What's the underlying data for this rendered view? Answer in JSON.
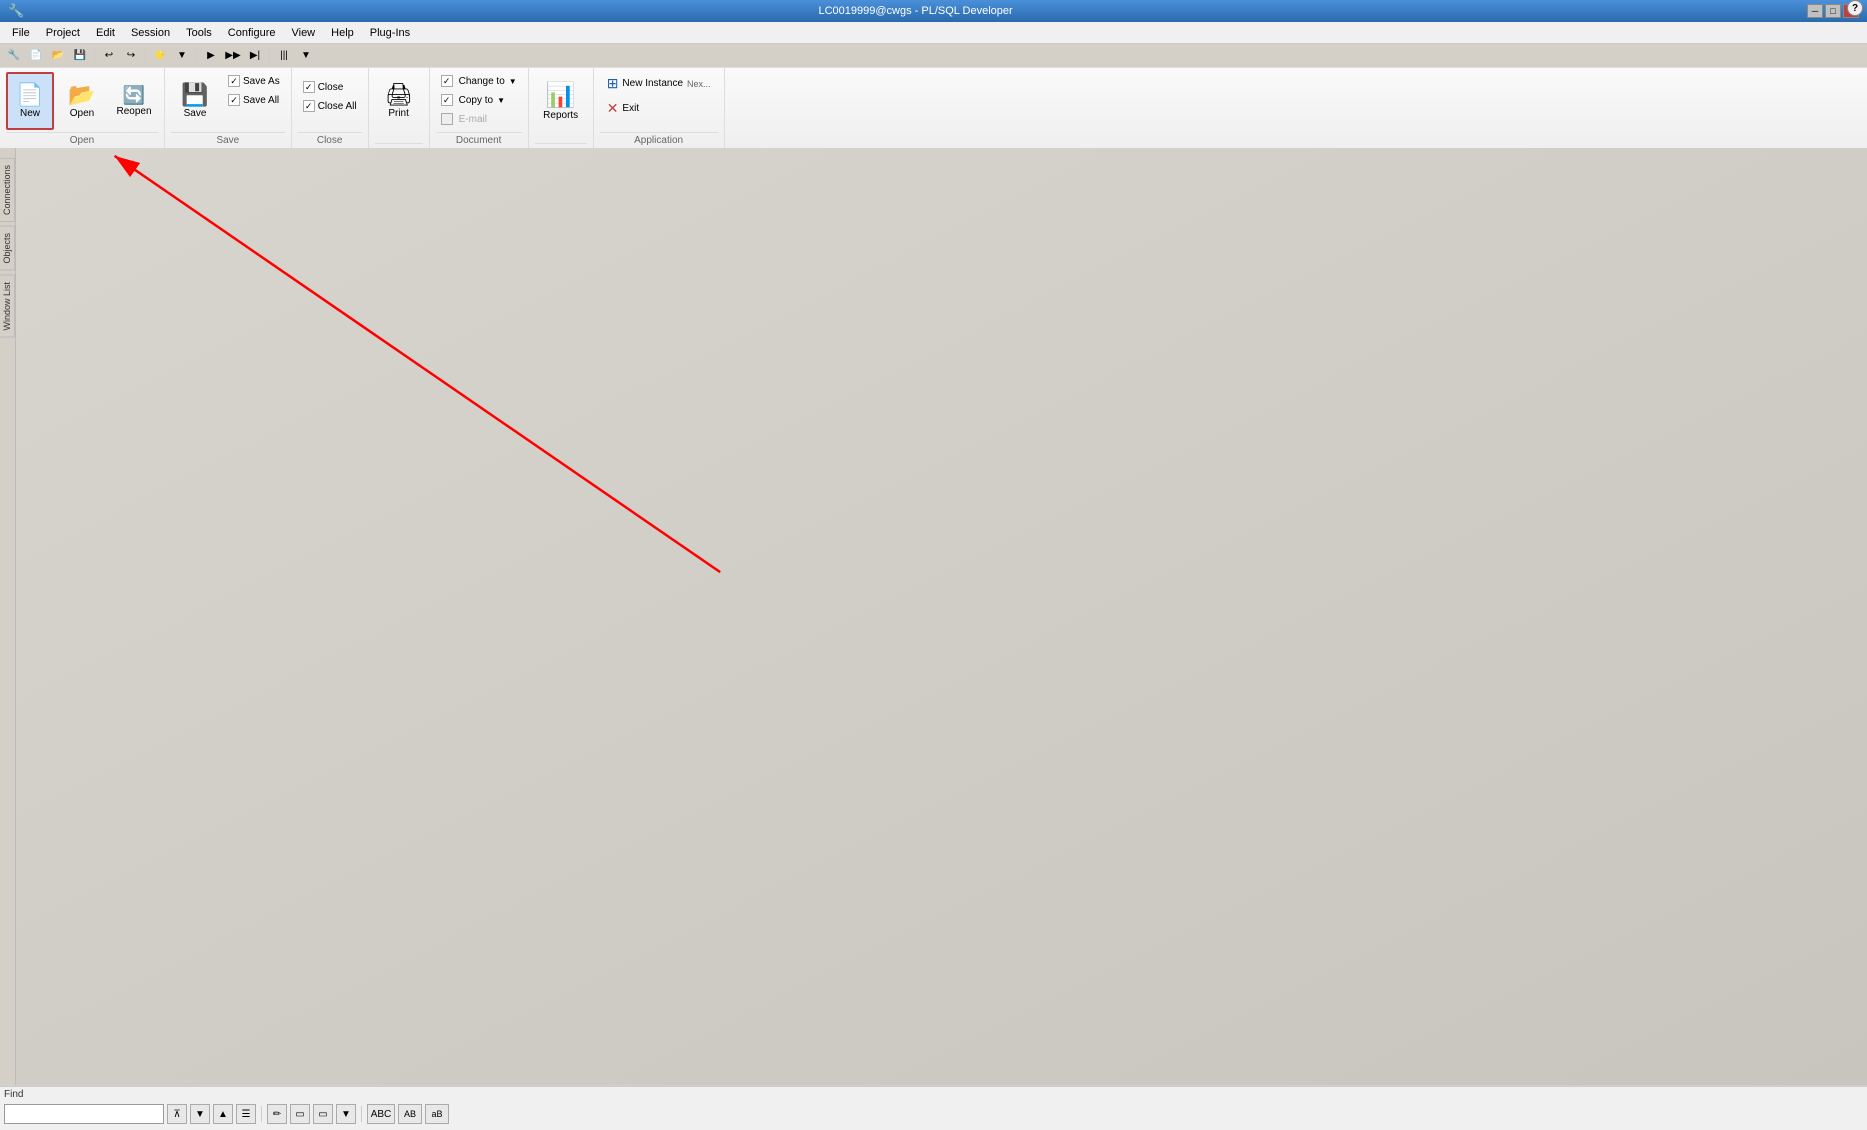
{
  "titlebar": {
    "title": "LC0019999@cwgs - PL/SQL Developer",
    "minimize": "─",
    "maximize": "□",
    "close": "✕"
  },
  "menubar": {
    "items": [
      "File",
      "Project",
      "Edit",
      "Session",
      "Tools",
      "Configure",
      "View",
      "Help",
      "Plug-Ins"
    ]
  },
  "quicktoolbar": {
    "buttons": [
      "🖥",
      "📄",
      "📁",
      "💾",
      "◀",
      "▶",
      "⟲",
      "⟳",
      "✂",
      "📋",
      "🔍",
      "⚙",
      "▶"
    ]
  },
  "ribbon": {
    "groups": [
      {
        "name": "Open",
        "label": "Open",
        "items": [
          {
            "type": "large",
            "icon": "📄",
            "label": "New",
            "active": true
          },
          {
            "type": "large",
            "icon": "📂",
            "label": "Open"
          },
          {
            "type": "large",
            "icon": "🔄",
            "label": "Reopen"
          }
        ]
      },
      {
        "name": "Save",
        "label": "Save",
        "items": [
          {
            "type": "large",
            "icon": "💾",
            "label": "Save"
          },
          {
            "type": "small",
            "icon": "💾",
            "label": "Save As",
            "checkbox": true
          },
          {
            "type": "small",
            "icon": "💾",
            "label": "Save All",
            "checkbox": true
          }
        ]
      },
      {
        "name": "Close",
        "label": "Close",
        "items": [
          {
            "type": "small",
            "icon": "✕",
            "label": "Close",
            "checkbox": true
          },
          {
            "type": "small",
            "icon": "✕",
            "label": "Close All",
            "checkbox": true
          }
        ]
      },
      {
        "name": "Print",
        "label": "",
        "items": [
          {
            "type": "large",
            "icon": "🖨",
            "label": "Print"
          }
        ]
      },
      {
        "name": "Document",
        "label": "Document",
        "items": [
          {
            "type": "small-arrow",
            "icon": "📋",
            "label": "Change to"
          },
          {
            "type": "small-arrow",
            "icon": "📋",
            "label": "Copy to"
          },
          {
            "type": "small",
            "icon": "📧",
            "label": "E-mail",
            "checkbox": true,
            "disabled": true
          }
        ]
      },
      {
        "name": "Reports",
        "label": "",
        "items": [
          {
            "type": "large-reports",
            "icon": "📊",
            "label": "Reports"
          }
        ]
      },
      {
        "name": "Application",
        "label": "Application",
        "items": [
          {
            "type": "app",
            "icon": "➕",
            "label": "New Instance"
          },
          {
            "type": "app",
            "icon": "🚪",
            "label": "Exit"
          }
        ]
      }
    ]
  },
  "sidepanels": {
    "tabs": [
      "Connections",
      "Objects",
      "Window List"
    ]
  },
  "findbar": {
    "label": "Find",
    "placeholder": "",
    "buttons": [
      "▲",
      "▼",
      "▲",
      "☰",
      "✏",
      "🔲",
      "🔲",
      "▼",
      "ABC",
      "AB",
      "AB"
    ]
  }
}
